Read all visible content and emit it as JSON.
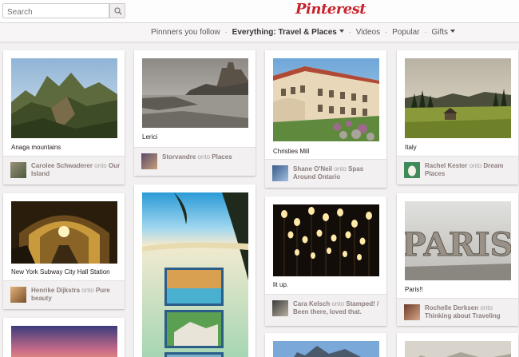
{
  "search": {
    "placeholder": "Search"
  },
  "brand": {
    "logo": "Pinterest"
  },
  "nav": {
    "items": [
      "Pinnners you follow",
      "Everything: Travel & Places",
      "Videos",
      "Popular",
      "Gifts"
    ],
    "separator": "·"
  },
  "attribution_word": "onto",
  "pins": [
    {
      "desc": "Anaga mountains",
      "user": "Carolee Schwaderer",
      "board": "Our Island"
    },
    {
      "desc": "New York Subway City Hall Station",
      "user": "Henrike Dijkstra",
      "board": "Pure beauty"
    },
    {
      "desc": "Lerici",
      "user": "Storvandre",
      "board": "Places"
    },
    {
      "desc": "Christies Mill",
      "user": "Shane O'Neil",
      "board": "Spas Around Ontario"
    },
    {
      "desc": "lit up.",
      "user": "Cara Kelsch",
      "board": "Stamped! / Been there, loved that."
    },
    {
      "desc": "Italy",
      "user": "Rachel Kester",
      "board": "Dream Places"
    },
    {
      "desc": "Paris!!",
      "user": "Rochelle Derksen",
      "board": "Thinking about Traveling"
    }
  ],
  "pictures": {
    "paris_letters": "PARIS"
  },
  "colors": {
    "brand_red": "#c8232c",
    "background": "#f2f0f0"
  }
}
